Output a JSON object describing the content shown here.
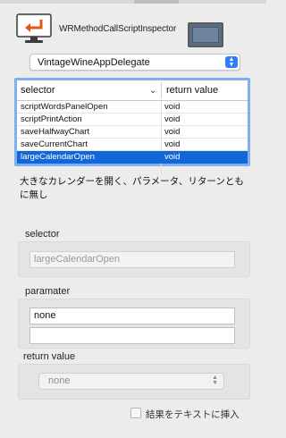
{
  "window": {
    "title": "WRMethodCallScriptInspector"
  },
  "icons": {
    "app": "script-arrow-icon",
    "window": "window-preview-icon"
  },
  "delegate_popup": {
    "value": "VintageWineAppDelegate"
  },
  "table": {
    "headers": {
      "selector": "selector",
      "return_value": "return value"
    },
    "rows": [
      {
        "selector": "scriptWordsPanelOpen",
        "return_value": "void"
      },
      {
        "selector": "scriptPrintAction",
        "return_value": "void"
      },
      {
        "selector": "saveHalfwayChart",
        "return_value": "void"
      },
      {
        "selector": "saveCurrentChart",
        "return_value": "void"
      },
      {
        "selector": "largeCalendarOpen",
        "return_value": "void"
      },
      {
        "selector": "",
        "return_value": ""
      }
    ],
    "selected_row": "largeCalendarOpen"
  },
  "description": "大きなカレンダーを開く、パラメータ、リターンともに無し",
  "selector_section": {
    "label": "selector",
    "value": "largeCalendarOpen"
  },
  "parameter_section": {
    "label": "paramater",
    "values": [
      "none",
      ""
    ]
  },
  "return_section": {
    "label": "return value",
    "value": "none"
  },
  "insert_checkbox": {
    "label": "結果をテキストに挿入",
    "checked": false
  },
  "colors": {
    "accent": "#1166d8",
    "table_focus": "#7fb0f2",
    "popup_arrow": "#2f7df6"
  }
}
